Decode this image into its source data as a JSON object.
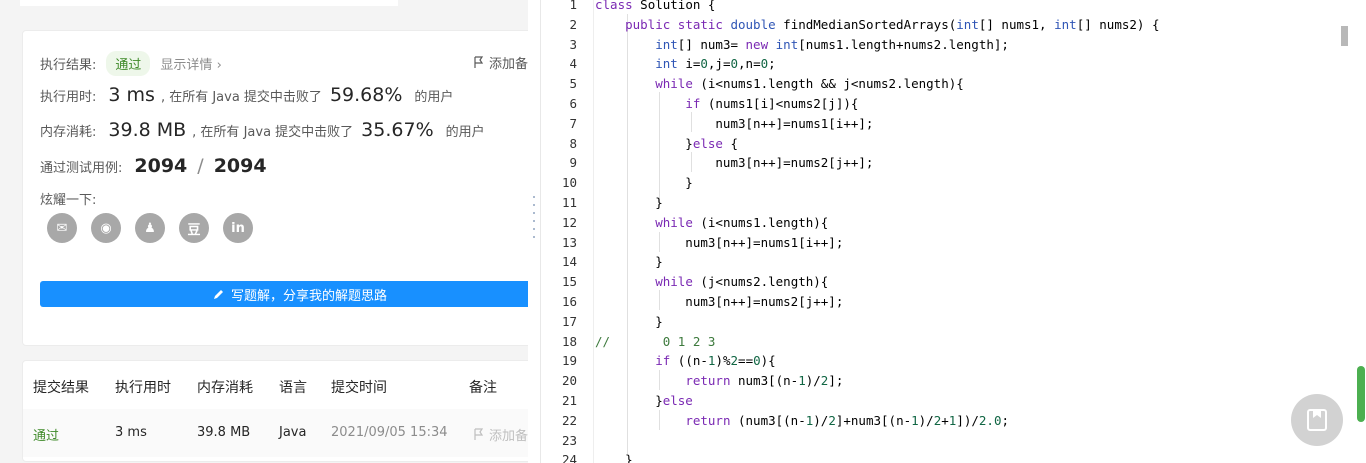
{
  "result": {
    "label": "执行结果:",
    "status": "通过",
    "details_link": "显示详情",
    "details_arrow": "›",
    "add_note": "添加备",
    "time_label": "执行用时:",
    "time_value": "3 ms",
    "time_text": ", 在所有 Java 提交中击败了",
    "time_pct": "59.68",
    "pct_unit": "%",
    "users_text": "的用户",
    "mem_label": "内存消耗:",
    "mem_value": "39.8 MB",
    "mem_text": ", 在所有 Java 提交中击败了",
    "mem_pct": "35.67",
    "tests_label": "通过测试用例:",
    "tests_passed": "2094",
    "tests_sep": "/",
    "tests_total": "2094",
    "share_label": "炫耀一下:",
    "share_icons": [
      "wechat-icon",
      "weibo-icon",
      "qq-icon",
      "douban-icon",
      "linkedin-icon"
    ],
    "share_glyphs": [
      "✉",
      "◉",
      "♟",
      "豆",
      "in"
    ],
    "solution_button": "写题解，分享我的解题思路"
  },
  "submissions": {
    "headers": [
      "提交结果",
      "执行用时",
      "内存消耗",
      "语言",
      "提交时间",
      "备注"
    ],
    "row": {
      "status": "通过",
      "time": "3 ms",
      "memory": "39.8 MB",
      "language": "Java",
      "submitted": "2021/09/05 15:34",
      "note": "添加备"
    }
  },
  "colors": {
    "accent": "#1890ff",
    "pass_green": "#3f8a29",
    "keyword": "#7a29b3",
    "type": "#2f55b5",
    "comment": "#3d7a3d"
  },
  "code": {
    "lines": [
      {
        "n": "1",
        "text": "class Solution {"
      },
      {
        "n": "2",
        "text": "    public static double findMedianSortedArrays(int[] nums1, int[] nums2) {"
      },
      {
        "n": "3",
        "text": "        int[] num3= new int[nums1.length+nums2.length];"
      },
      {
        "n": "4",
        "text": "        int i=0,j=0,n=0;"
      },
      {
        "n": "5",
        "text": "        while (i<nums1.length && j<nums2.length){"
      },
      {
        "n": "6",
        "text": "            if (nums1[i]<nums2[j]){"
      },
      {
        "n": "7",
        "text": "                num3[n++]=nums1[i++];"
      },
      {
        "n": "8",
        "text": "            }else {"
      },
      {
        "n": "9",
        "text": "                num3[n++]=nums2[j++];"
      },
      {
        "n": "10",
        "text": "            }"
      },
      {
        "n": "11",
        "text": "        }"
      },
      {
        "n": "12",
        "text": "        while (i<nums1.length){"
      },
      {
        "n": "13",
        "text": "            num3[n++]=nums1[i++];"
      },
      {
        "n": "14",
        "text": "        }"
      },
      {
        "n": "15",
        "text": "        while (j<nums2.length){"
      },
      {
        "n": "16",
        "text": "            num3[n++]=nums2[j++];"
      },
      {
        "n": "17",
        "text": "        }"
      },
      {
        "n": "18",
        "text": "//       0 1 2 3"
      },
      {
        "n": "19",
        "text": "        if ((n-1)%2==0){"
      },
      {
        "n": "20",
        "text": "            return num3[(n-1)/2];"
      },
      {
        "n": "21",
        "text": "        }else"
      },
      {
        "n": "22",
        "text": "            return (num3[(n-1)/2]+num3[(n-1)/2+1])/2.0;"
      },
      {
        "n": "23",
        "text": ""
      },
      {
        "n": "24",
        "text": "    }"
      }
    ]
  }
}
